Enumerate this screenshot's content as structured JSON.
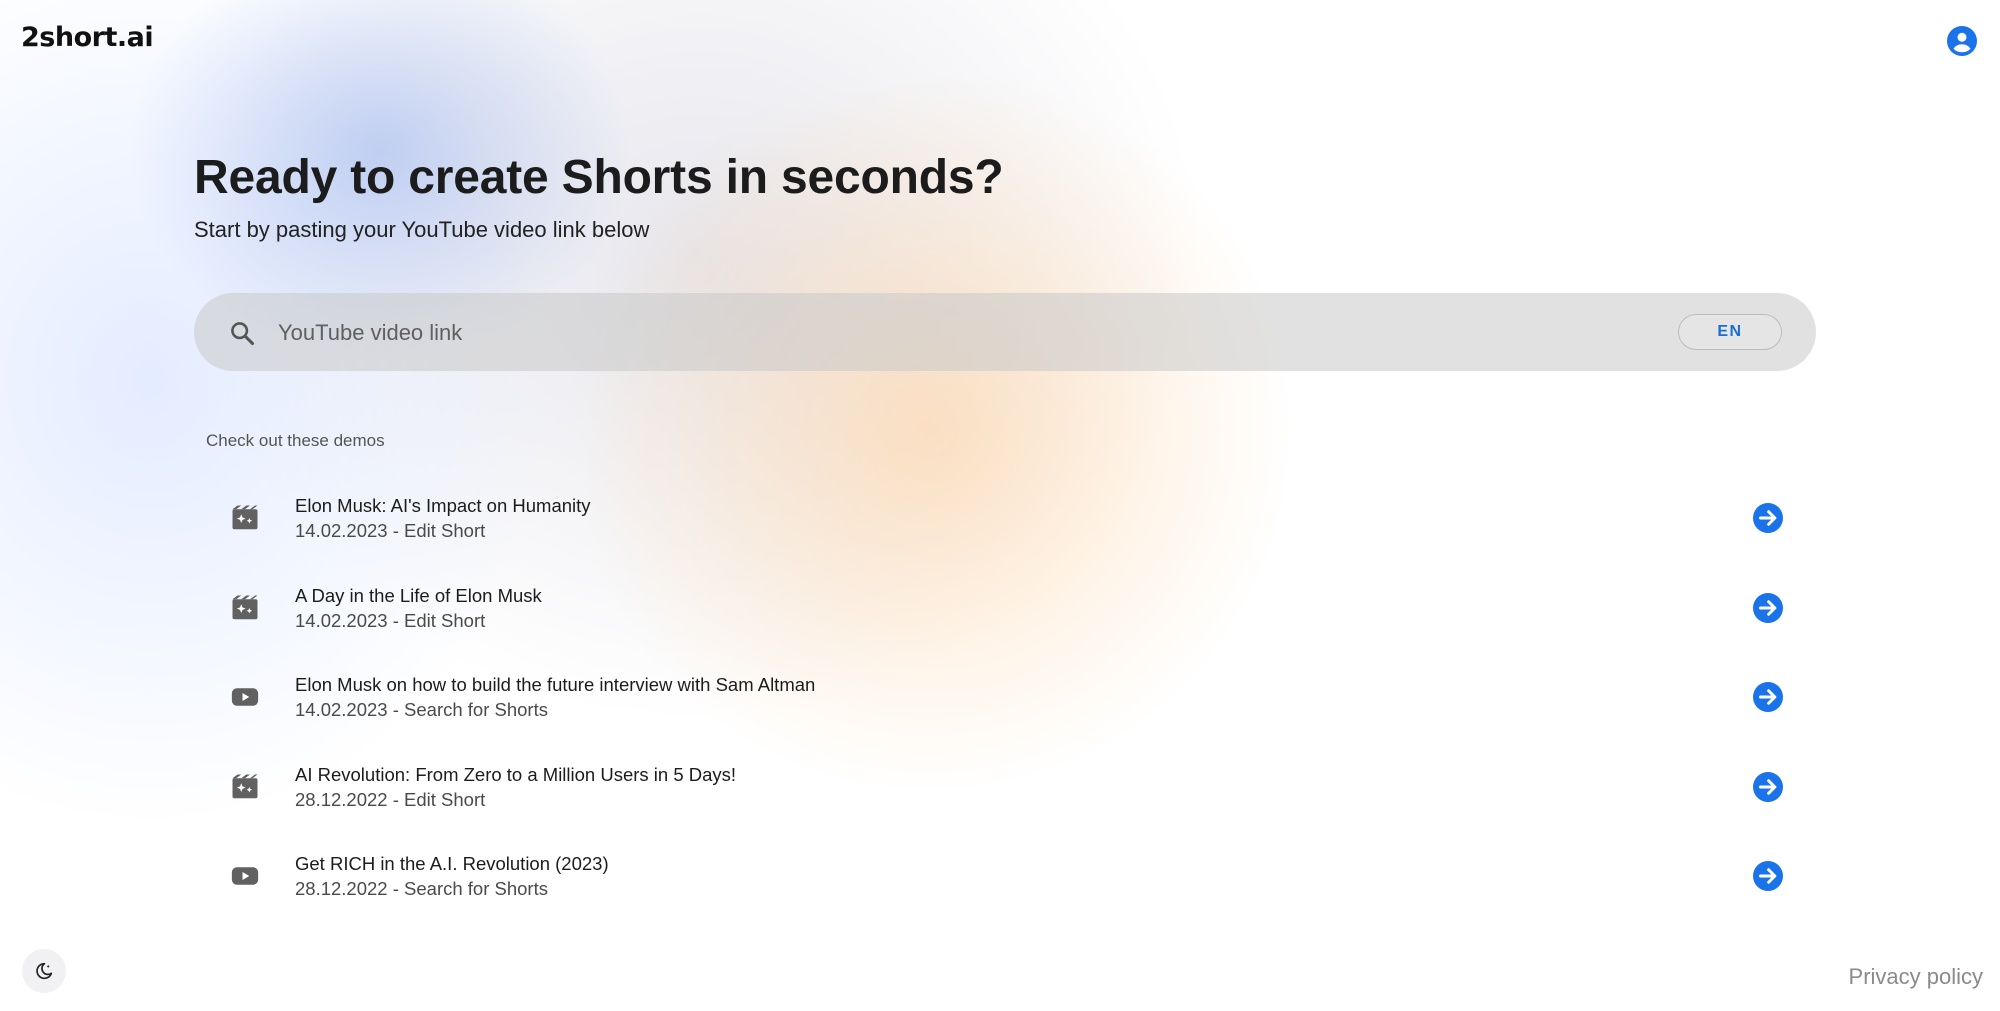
{
  "header": {
    "logo_text": "2short.ai",
    "account_icon": "account-circle-icon"
  },
  "hero": {
    "title": "Ready to create Shorts in seconds?",
    "subtitle": "Start by pasting your YouTube video link below"
  },
  "search": {
    "placeholder": "YouTube video link",
    "value": "",
    "icon": "search-icon",
    "language_button": "EN"
  },
  "demos": {
    "heading": "Check out these demos",
    "items": [
      {
        "title": "Elon Musk: AI's Impact on Humanity",
        "meta": "14.02.2023 - Edit Short",
        "icon": "movie-edit-icon"
      },
      {
        "title": "A Day in the Life of Elon Musk",
        "meta": "14.02.2023 - Edit Short",
        "icon": "movie-edit-icon"
      },
      {
        "title": "Elon Musk on how to build the future interview with Sam Altman",
        "meta": "14.02.2023 - Search for Shorts",
        "icon": "youtube-icon"
      },
      {
        "title": "AI Revolution: From Zero to a Million Users in 5 Days!",
        "meta": "28.12.2022 - Edit Short",
        "icon": "movie-edit-icon"
      },
      {
        "title": "Get RICH in the A.I. Revolution (2023)",
        "meta": "28.12.2022 - Search for Shorts",
        "icon": "youtube-icon"
      }
    ]
  },
  "footer": {
    "theme_toggle_icon": "dark-mode-icon",
    "privacy_link": "Privacy policy"
  },
  "colors": {
    "accent": "#1a73e8",
    "icon_gray": "#616161",
    "search_bar": "#d6d6d6"
  }
}
